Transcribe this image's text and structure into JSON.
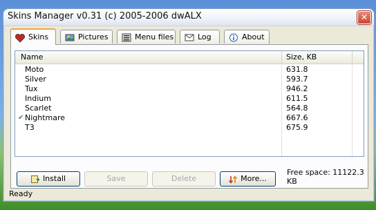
{
  "window": {
    "title": "Skins Manager v0.31 (c) 2005-2006 dwALX",
    "close_label": "✕"
  },
  "tabs": [
    {
      "label": "Skins",
      "icon": "heart-icon"
    },
    {
      "label": "Pictures",
      "icon": "pictures-icon"
    },
    {
      "label": "Menu files",
      "icon": "menu-files-icon"
    },
    {
      "label": "Log",
      "icon": "log-icon"
    },
    {
      "label": "About",
      "icon": "info-icon"
    }
  ],
  "list": {
    "columns": {
      "name": "Name",
      "size": "Size, KB"
    },
    "rows": [
      {
        "name": "Moto",
        "size": "631.8",
        "active": false
      },
      {
        "name": "Silver",
        "size": "593.7",
        "active": false
      },
      {
        "name": "Tux",
        "size": "946.2",
        "active": false
      },
      {
        "name": "Indium",
        "size": "611.5",
        "active": false
      },
      {
        "name": "Scarlet",
        "size": "564.8",
        "active": false
      },
      {
        "name": "Nightmare",
        "size": "667.6",
        "active": true
      },
      {
        "name": "T3",
        "size": "675.9",
        "active": false
      }
    ]
  },
  "buttons": {
    "install": "Install",
    "save": "Save",
    "delete": "Delete",
    "more": "More..."
  },
  "free_space": "Free space: 11122.3 KB",
  "status": "Ready",
  "colors": {
    "tab_accent": "#f3a33b",
    "check": "#2f9a2f",
    "close": "#c6472e"
  }
}
